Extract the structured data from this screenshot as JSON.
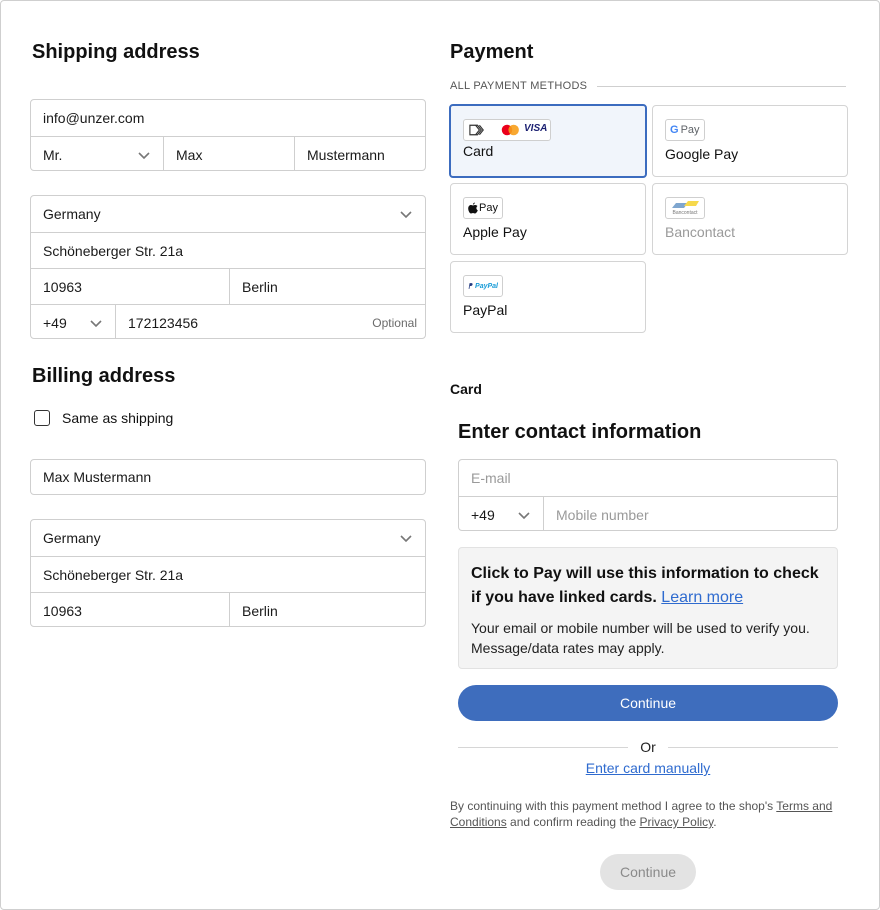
{
  "shipping": {
    "title": "Shipping address",
    "email": "info@unzer.com",
    "salutation": "Mr.",
    "first_name": "Max",
    "last_name": "Mustermann",
    "country": "Germany",
    "street": "Schöneberger Str. 21a",
    "zip": "10963",
    "city": "Berlin",
    "phone_prefix": "+49",
    "phone": "172123456",
    "phone_optional": "Optional"
  },
  "billing": {
    "title": "Billing address",
    "same_as_shipping": "Same as shipping",
    "same_as_shipping_checked": false,
    "name": "Max Mustermann",
    "country": "Germany",
    "street": "Schöneberger Str. 21a",
    "zip": "10963",
    "city": "Berlin"
  },
  "payment": {
    "title": "Payment",
    "all_methods": "ALL PAYMENT METHODS",
    "methods": [
      {
        "label": "Card",
        "selected": true,
        "enabled": true
      },
      {
        "label": "Google Pay",
        "selected": false,
        "enabled": true
      },
      {
        "label": "Apple Pay",
        "selected": false,
        "enabled": true
      },
      {
        "label": "Bancontact",
        "selected": false,
        "enabled": false
      },
      {
        "label": "PayPal",
        "selected": false,
        "enabled": true
      }
    ],
    "logos": {
      "visa": "VISA",
      "gpay_g": "G",
      "gpay_text": "Pay",
      "apple_text": "Pay",
      "paypal": "PayPal",
      "bancontact": "Bancontact"
    },
    "section_label": "Card"
  },
  "contact": {
    "title": "Enter contact information",
    "email_placeholder": "E-mail",
    "phone_prefix": "+49",
    "mobile_placeholder": "Mobile number",
    "info_strong": "Click to Pay will use this information to check if you have linked cards.",
    "learn_more": "Learn more",
    "info_small": "Your email or mobile number will be used to verify you. Message/data rates may apply.",
    "continue": "Continue",
    "or": "Or",
    "enter_manually": "Enter card manually"
  },
  "legal": {
    "prefix": "By continuing with this payment method I agree to the shop's",
    "terms": "Terms and Conditions",
    "middle": "and confirm reading the",
    "privacy": "Privacy Policy",
    "suffix": "."
  },
  "footer": {
    "continue": "Continue"
  },
  "colors": {
    "accent": "#3e6dbd",
    "link": "#2f6bcf",
    "selected_border": "#3c6cbf"
  }
}
